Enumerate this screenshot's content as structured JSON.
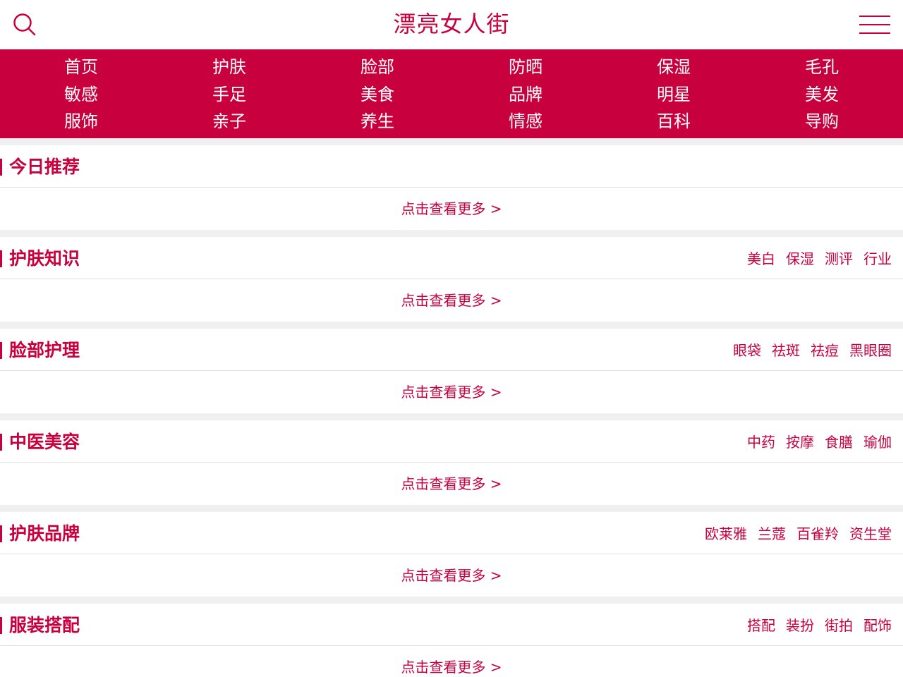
{
  "header": {
    "title": "漂亮女人街",
    "search_icon": "search-icon",
    "menu_icon": "hamburger-menu-icon"
  },
  "nav": {
    "items": [
      {
        "label": "首页"
      },
      {
        "label": "护肤"
      },
      {
        "label": "脸部"
      },
      {
        "label": "防晒"
      },
      {
        "label": "保湿"
      },
      {
        "label": "毛孔"
      },
      {
        "label": "敏感"
      },
      {
        "label": "手足"
      },
      {
        "label": "美食"
      },
      {
        "label": "品牌"
      },
      {
        "label": "明星"
      },
      {
        "label": "美发"
      },
      {
        "label": "服饰"
      },
      {
        "label": "亲子"
      },
      {
        "label": "养生"
      },
      {
        "label": "情感"
      },
      {
        "label": "百科"
      },
      {
        "label": "导购"
      }
    ]
  },
  "sections": [
    {
      "title": "今日推荐",
      "tags": [],
      "more": "点击查看更多 >"
    },
    {
      "title": "护肤知识",
      "tags": [
        "美白",
        "保湿",
        "测评",
        "行业"
      ],
      "more": "点击查看更多 >"
    },
    {
      "title": "脸部护理",
      "tags": [
        "眼袋",
        "祛斑",
        "祛痘",
        "黑眼圈"
      ],
      "more": "点击查看更多 >"
    },
    {
      "title": "中医美容",
      "tags": [
        "中药",
        "按摩",
        "食膳",
        "瑜伽"
      ],
      "more": "点击查看更多 >"
    },
    {
      "title": "护肤品牌",
      "tags": [
        "欧莱雅",
        "兰蔻",
        "百雀羚",
        "资生堂"
      ],
      "more": "点击查看更多 >"
    },
    {
      "title": "服装搭配",
      "tags": [
        "搭配",
        "装扮",
        "街拍",
        "配饰"
      ],
      "more": "点击查看更多 >"
    }
  ],
  "colors": {
    "accent": "#c8003d",
    "divider_bg": "#f0f0f0"
  }
}
